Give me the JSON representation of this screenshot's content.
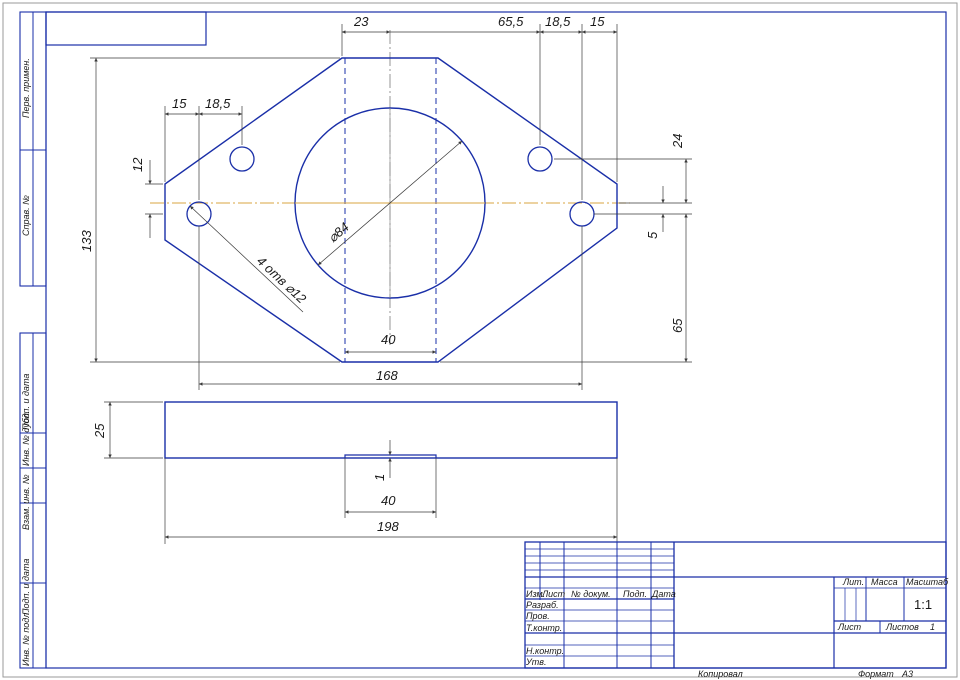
{
  "dimensions": {
    "top_23": "23",
    "top_65_5": "65,5",
    "top_18_5": "18,5",
    "top_15": "15",
    "left_15": "15",
    "left_18_5": "18,5",
    "left_12": "12",
    "right_24": "24",
    "right_5": "5",
    "height_133": "133",
    "right_65": "65",
    "hole_diameter": "⌀84",
    "holes_note": "4 отв ⌀12",
    "slot_width_top": "40",
    "width_168": "168",
    "thickness_25": "25",
    "recess_1": "1",
    "slot_width_bottom": "40",
    "width_198": "198"
  },
  "side_stamp": {
    "perv_primen": "Перв. примен.",
    "sprav_no": "Справ. №",
    "podp_data_1": "Подп. и дата",
    "inv_dubl": "Инв. № дубл.",
    "vzam_inv": "Взам. инв. №",
    "podp_data_2": "Подп. и дата",
    "inv_podl": "Инв. № подл."
  },
  "title_block": {
    "izm": "Изм.",
    "list": "Лист",
    "no_dokum": "№ докум.",
    "podp": "Подп.",
    "data": "Дата",
    "razrab": "Разраб.",
    "prov": "Пров.",
    "t_kontr": "Т.контр.",
    "n_kontr": "Н.контр.",
    "utv": "Утв.",
    "lit": "Лит.",
    "massa": "Масса",
    "masshtab": "Масштаб",
    "scale_value": "1:1",
    "list2": "Лист",
    "listov": "Листов",
    "listov_value": "1"
  },
  "footer": {
    "kopiroval": "Копировал",
    "format": "Формат",
    "format_value": "A3"
  },
  "colors": {
    "outline": "#1a2fa8",
    "centerline": "#d9a640",
    "dimension": "#3a3a3a"
  }
}
